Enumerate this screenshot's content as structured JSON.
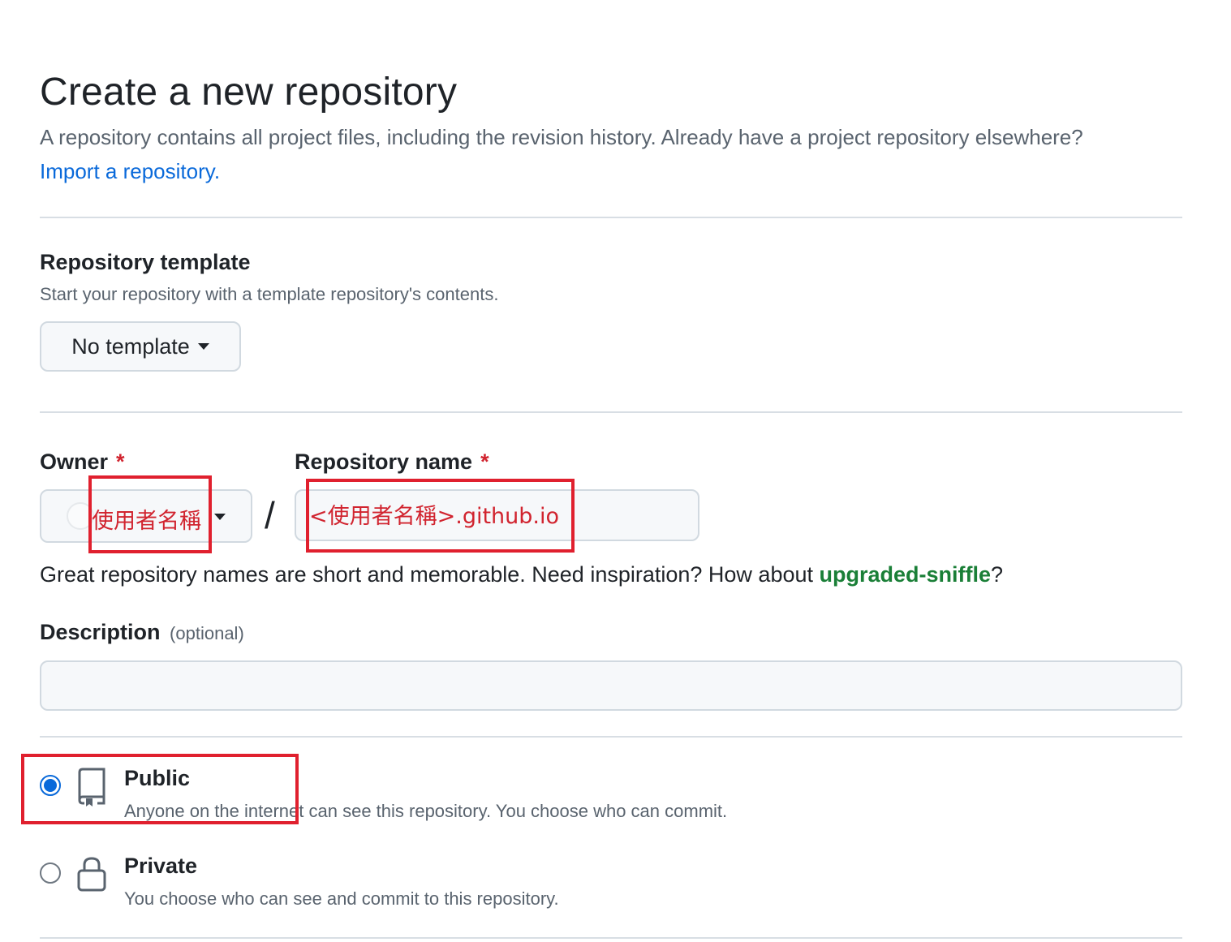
{
  "header": {
    "title": "Create a new repository",
    "subtitle": "A repository contains all project files, including the revision history. Already have a project repository elsewhere?",
    "import_link": "Import a repository."
  },
  "template": {
    "label": "Repository template",
    "note": "Start your repository with a template repository's contents.",
    "selected": "No template",
    "icon": "triangle-down-icon"
  },
  "owner": {
    "label": "Owner",
    "required_mark": "*",
    "value": "使用者名稱",
    "icon": "triangle-down-icon"
  },
  "separator": "/",
  "repo_name": {
    "label": "Repository name",
    "required_mark": "*",
    "value": "<使用者名稱>.github.io"
  },
  "name_hint": {
    "prefix": "Great repository names are short and memorable. Need inspiration? How about ",
    "suggestion": "upgraded-sniffle",
    "suffix": "?"
  },
  "description": {
    "label": "Description",
    "optional": "(optional)",
    "value": ""
  },
  "visibility": {
    "options": [
      {
        "title": "Public",
        "note": "Anyone on the internet can see this repository. You choose who can commit.",
        "icon": "repo-icon",
        "selected": true
      },
      {
        "title": "Private",
        "note": "You choose who can see and commit to this repository.",
        "icon": "lock-icon",
        "selected": false
      }
    ]
  },
  "colors": {
    "link": "#0969da",
    "suggestion": "#1a7f37",
    "required": "#d1242f",
    "annotation_box": "#e0202e"
  }
}
